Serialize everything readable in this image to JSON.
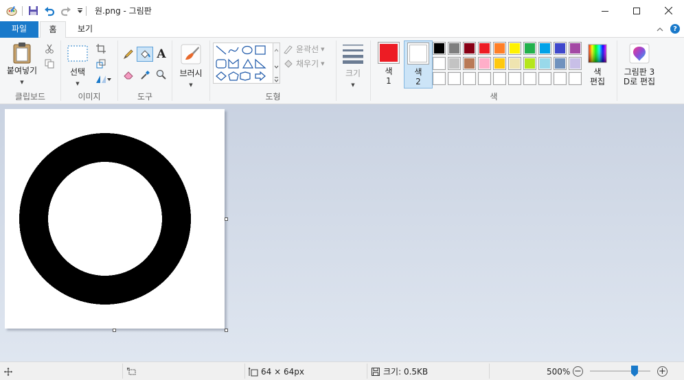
{
  "window": {
    "title": "원.png - 그림판"
  },
  "tabs": {
    "file": "파일",
    "home": "홈",
    "view": "보기"
  },
  "ribbon": {
    "clipboard": {
      "paste": "붙여넣기",
      "group": "클립보드"
    },
    "image": {
      "select": "선택",
      "group": "이미지"
    },
    "tools": {
      "group": "도구"
    },
    "brushes": {
      "label": "브러시"
    },
    "shapes": {
      "outline": "윤곽선",
      "fill": "채우기",
      "group": "도형"
    },
    "size": {
      "label": "크기"
    },
    "colors": {
      "color1_label": "색",
      "color1_num": "1",
      "color2_label": "색",
      "color2_num": "2",
      "edit_label1": "색",
      "edit_label2": "편집",
      "group": "색",
      "color1_value": "#ed1c24",
      "color2_value": "#ffffff",
      "palette_row1": [
        "#000000",
        "#7f7f7f",
        "#880015",
        "#ed1c24",
        "#ff7f27",
        "#fff200",
        "#22b14c",
        "#00a2e8",
        "#3f48cc",
        "#a349a4"
      ],
      "palette_row2": [
        "#ffffff",
        "#c3c3c3",
        "#b97a57",
        "#ffaec9",
        "#ffc90e",
        "#efe4b0",
        "#b5e61d",
        "#99d9ea",
        "#7092be",
        "#c8bfe7"
      ],
      "palette_row3": [
        "#ffffff",
        "#ffffff",
        "#ffffff",
        "#ffffff",
        "#ffffff",
        "#ffffff",
        "#ffffff",
        "#ffffff",
        "#ffffff",
        "#ffffff"
      ]
    },
    "paint3d": {
      "line1": "그림판 3",
      "line2": "D로 편집"
    }
  },
  "status": {
    "dimensions": "64 × 64px",
    "size": "크기: 0.5KB",
    "zoom": "500%"
  }
}
